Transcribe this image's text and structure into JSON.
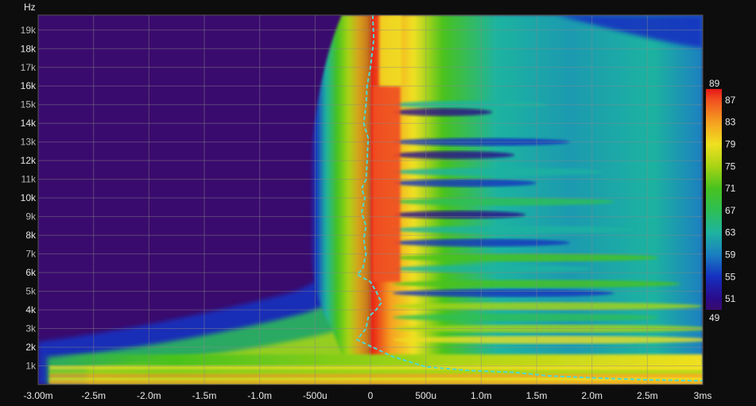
{
  "chart_data": {
    "type": "heatmap",
    "title": "",
    "xlabel": "",
    "ylabel": "",
    "y_unit": "Hz",
    "x_unit_suffix": "ms",
    "xlim": [
      -3.0,
      3.0
    ],
    "ylim": [
      0,
      19800
    ],
    "grid": true,
    "x_ticks": [
      {
        "value": -3.0,
        "label": "-3.00m"
      },
      {
        "value": -2.5,
        "label": "-2.5m"
      },
      {
        "value": -2.0,
        "label": "-2.0m"
      },
      {
        "value": -1.5,
        "label": "-1.5m"
      },
      {
        "value": -1.0,
        "label": "-1.0m"
      },
      {
        "value": -0.5,
        "label": "-500u"
      },
      {
        "value": 0.0,
        "label": "0"
      },
      {
        "value": 0.5,
        "label": "500u"
      },
      {
        "value": 1.0,
        "label": "1.0m"
      },
      {
        "value": 1.5,
        "label": "1.5m"
      },
      {
        "value": 2.0,
        "label": "2.0m"
      },
      {
        "value": 2.5,
        "label": "2.5m"
      },
      {
        "value": 3.0,
        "label": "3"
      }
    ],
    "y_ticks": [
      {
        "value": 1000,
        "label": "1k"
      },
      {
        "value": 2000,
        "label": "2k"
      },
      {
        "value": 3000,
        "label": "3k"
      },
      {
        "value": 4000,
        "label": "4k"
      },
      {
        "value": 5000,
        "label": "5k"
      },
      {
        "value": 6000,
        "label": "6k"
      },
      {
        "value": 7000,
        "label": "7k"
      },
      {
        "value": 8000,
        "label": "8k"
      },
      {
        "value": 9000,
        "label": "9k"
      },
      {
        "value": 10000,
        "label": "10k"
      },
      {
        "value": 11000,
        "label": "11k"
      },
      {
        "value": 12000,
        "label": "12k"
      },
      {
        "value": 13000,
        "label": "13k"
      },
      {
        "value": 14000,
        "label": "14k"
      },
      {
        "value": 15000,
        "label": "15k"
      },
      {
        "value": 16000,
        "label": "16k"
      },
      {
        "value": 17000,
        "label": "17k"
      },
      {
        "value": 18000,
        "label": "18k"
      },
      {
        "value": 19000,
        "label": "19k"
      }
    ],
    "colorbar": {
      "min": 49,
      "max": 89,
      "labels": [
        89,
        87,
        83,
        79,
        75,
        71,
        67,
        63,
        59,
        55,
        51,
        49
      ],
      "stops": [
        {
          "value": 49,
          "color": "#3a0b6e"
        },
        {
          "value": 51,
          "color": "#2a0a8a"
        },
        {
          "value": 55,
          "color": "#1530c0"
        },
        {
          "value": 59,
          "color": "#1a7fc0"
        },
        {
          "value": 63,
          "color": "#1fb3a0"
        },
        {
          "value": 67,
          "color": "#2dbf55"
        },
        {
          "value": 71,
          "color": "#48c21f"
        },
        {
          "value": 75,
          "color": "#a8d414"
        },
        {
          "value": 79,
          "color": "#f0e020"
        },
        {
          "value": 83,
          "color": "#f5a020"
        },
        {
          "value": 87,
          "color": "#f05020"
        },
        {
          "value": 89,
          "color": "#e81616"
        }
      ]
    },
    "peak_curve": {
      "color": "#4fd8d0",
      "points": [
        [
          0.02,
          19800
        ],
        [
          0.03,
          18500
        ],
        [
          0.0,
          17000
        ],
        [
          -0.03,
          16000
        ],
        [
          -0.04,
          15000
        ],
        [
          -0.06,
          14000
        ],
        [
          -0.02,
          13200
        ],
        [
          -0.03,
          12000
        ],
        [
          -0.04,
          11000
        ],
        [
          -0.08,
          10500
        ],
        [
          -0.05,
          10000
        ],
        [
          -0.08,
          9200
        ],
        [
          -0.04,
          8500
        ],
        [
          -0.06,
          7800
        ],
        [
          -0.04,
          7000
        ],
        [
          -0.07,
          6200
        ],
        [
          -0.12,
          5900
        ],
        [
          0.0,
          5500
        ],
        [
          0.05,
          5000
        ],
        [
          0.1,
          4400
        ],
        [
          0.05,
          4000
        ],
        [
          -0.02,
          3600
        ],
        [
          -0.04,
          3000
        ],
        [
          -0.12,
          2400
        ],
        [
          0.02,
          2000
        ],
        [
          0.2,
          1500
        ],
        [
          0.5,
          950
        ],
        [
          0.9,
          750
        ],
        [
          1.3,
          650
        ],
        [
          1.6,
          470
        ],
        [
          2.0,
          360
        ],
        [
          2.5,
          250
        ],
        [
          3.0,
          200
        ]
      ]
    }
  }
}
